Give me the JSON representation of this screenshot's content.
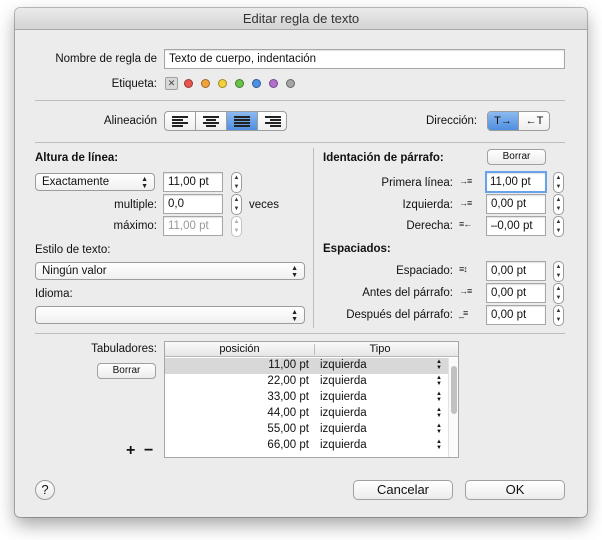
{
  "window": {
    "title": "Editar regla de texto"
  },
  "rule_name": {
    "label": "Nombre de regla de",
    "value": "Texto de cuerpo, indentación"
  },
  "tag": {
    "label": "Etiqueta:",
    "none_symbol": "✕",
    "colors": [
      "#e9564f",
      "#f2a23a",
      "#f3d23b",
      "#69c24a",
      "#4c90e6",
      "#b271d0",
      "#a4a4a4"
    ]
  },
  "alignment": {
    "label": "Alineación",
    "options": [
      "left",
      "center",
      "justify",
      "right"
    ],
    "selected": "justify"
  },
  "direction": {
    "label": "Dirección:",
    "ltr": "T→",
    "rtl": "←T",
    "selected": "ltr"
  },
  "line_height": {
    "heading": "Altura de línea:",
    "mode": "Exactamente",
    "value": "11,00 pt",
    "multiple_label": "multiple:",
    "multiple_value": "0,0",
    "multiple_unit": "veces",
    "max_label": "máximo:",
    "max_value": "11,00 pt"
  },
  "text_style": {
    "label": "Estilo de texto:",
    "value": "Ningún valor"
  },
  "language": {
    "label": "Idioma:",
    "value": ""
  },
  "indent": {
    "heading": "Identación de párrafo:",
    "reset_label": "Borrar",
    "first_line_label": "Primera línea:",
    "first_line_value": "11,00 pt",
    "left_label": "Izquierda:",
    "left_value": "0,00 pt",
    "right_label": "Derecha:",
    "right_value": "–0,00 pt"
  },
  "spacing": {
    "heading": "Espaciados:",
    "spacing_label": "Espaciado:",
    "spacing_value": "0,00 pt",
    "before_label": "Antes del párrafo:",
    "before_value": "0,00 pt",
    "after_label": "Después del párrafo:",
    "after_value": "0,00 pt"
  },
  "tabs": {
    "label": "Tabuladores:",
    "reset_label": "Borrar",
    "add_label": "+",
    "remove_label": "−",
    "columns": [
      "posición",
      "Tipo"
    ],
    "rows": [
      {
        "position": "11,00 pt",
        "type": "izquierda"
      },
      {
        "position": "22,00 pt",
        "type": "izquierda"
      },
      {
        "position": "33,00 pt",
        "type": "izquierda"
      },
      {
        "position": "44,00 pt",
        "type": "izquierda"
      },
      {
        "position": "55,00 pt",
        "type": "izquierda"
      },
      {
        "position": "66,00 pt",
        "type": "izquierda"
      }
    ]
  },
  "footer": {
    "help_label": "?",
    "cancel_label": "Cancelar",
    "ok_label": "OK"
  }
}
